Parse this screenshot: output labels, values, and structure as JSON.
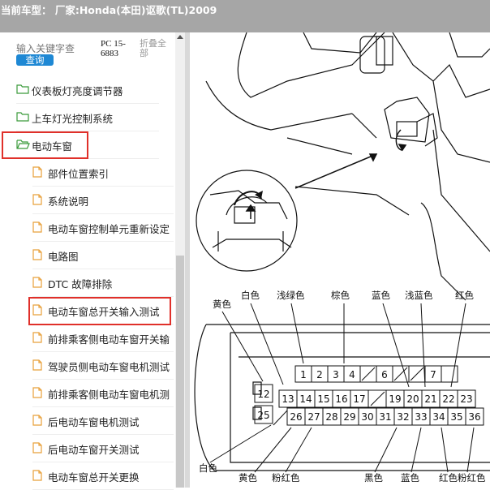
{
  "header": {
    "title": "当前车型： 厂家:Honda(本田)讴歌(TL)2009"
  },
  "search": {
    "placeholder": "输入关键字查",
    "button": "查询",
    "code": "PC 15-6883",
    "collapse_all": "折叠全部"
  },
  "tree": {
    "folders": [
      {
        "label": "仪表板灯亮度调节器"
      },
      {
        "label": "上车灯光控制系统"
      },
      {
        "label": "电动车窗",
        "open": true
      }
    ],
    "children": [
      {
        "label": "部件位置索引"
      },
      {
        "label": "系统说明"
      },
      {
        "label": "电动车窗控制单元重新设定"
      },
      {
        "label": "电路图"
      },
      {
        "label": "DTC 故障排除"
      },
      {
        "label": "电动车窗总开关输入测试"
      },
      {
        "label": "前排乘客侧电动车窗开关输"
      },
      {
        "label": "驾驶员侧电动车窗电机测试"
      },
      {
        "label": "前排乘客侧电动车窗电机测"
      },
      {
        "label": "后电动车窗电机测试"
      },
      {
        "label": "后电动车窗开关测试"
      },
      {
        "label": "电动车窗总开关更换"
      }
    ]
  },
  "diagram": {
    "top_labels": [
      "黄色",
      "白色",
      "浅绿色",
      "棕色",
      "蓝色",
      "浅蓝色",
      "红色"
    ],
    "bottom_labels": [
      "白色",
      "黄色",
      "粉红色",
      "黑色",
      "蓝色",
      "红色",
      "粉红色"
    ],
    "pins_row1": [
      "1",
      "2",
      "3",
      "4",
      "6",
      "7"
    ],
    "pins_row2": [
      "12",
      "13",
      "14",
      "15",
      "16",
      "17",
      "19",
      "20",
      "21",
      "22",
      "23"
    ],
    "pins_row3": [
      "25",
      "26",
      "27",
      "28",
      "29",
      "30",
      "31",
      "32",
      "33",
      "34",
      "35",
      "36"
    ]
  },
  "colors": {
    "titlebar": "#a6a6a6",
    "query_button": "#1e88d4",
    "highlight": "#e0302a",
    "folder": "#3a9a3a",
    "file": "#e8a03a"
  }
}
